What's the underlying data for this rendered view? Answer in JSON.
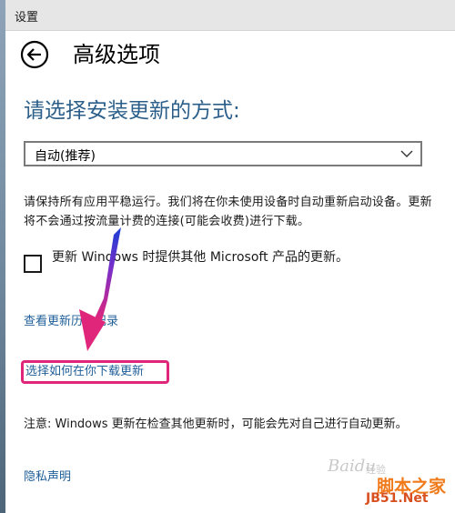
{
  "window": {
    "title": "设置"
  },
  "header": {
    "back_icon": "back-arrow-circle-icon",
    "title": "高级选项"
  },
  "install": {
    "heading": "请选择安装更新的方式:",
    "selected_option": "自动(推荐)"
  },
  "description": {
    "text": "请保持所有应用平稳运行。我们将在你未使用设备时自动重新启动设备。更新将不会通过按流量计费的连接(可能会收费)进行下载。"
  },
  "options": {
    "other_products_label": "更新 Windows 时提供其他 Microsoft 产品的更新。",
    "other_products_checked": false
  },
  "links": {
    "history": "查看更新历史记录",
    "choose_delivery": "选择如何在你下载更新",
    "privacy": "隐私声明"
  },
  "note": {
    "text": "注意: Windows 更新在检查其他更新时，可能会先对自己进行自动更新。"
  },
  "watermark": {
    "brand": "Baidu",
    "brand_sub": "经验",
    "site": "脚本之家",
    "domain": "JB51.Net"
  },
  "colors": {
    "accent_heading": "#2b5f8a",
    "link": "#1f5f99",
    "highlight_box": "#e0267a",
    "annotation_arrow": "#e0267a"
  }
}
